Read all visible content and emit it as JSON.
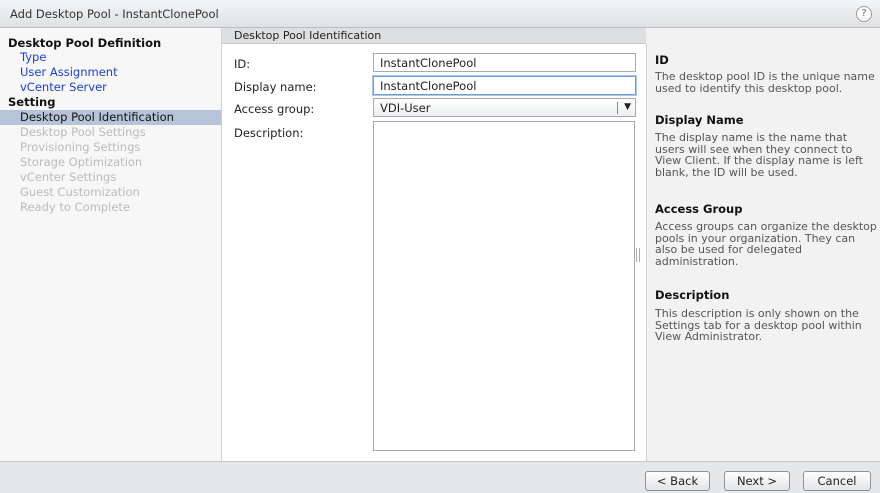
{
  "window": {
    "title": "Add Desktop Pool - InstantClonePool",
    "help_glyph": "?"
  },
  "sidebar": {
    "section1": "Desktop Pool Definition",
    "items1": [
      "Type",
      "User Assignment",
      "vCenter Server"
    ],
    "section2": "Setting",
    "items2": [
      "Desktop Pool Identification",
      "Desktop Pool Settings",
      "Provisioning Settings",
      "Storage Optimization",
      "vCenter Settings",
      "Guest Customization",
      "Ready to Complete"
    ]
  },
  "content": {
    "header": "Desktop Pool Identification",
    "id_label": "ID:",
    "id_value": "InstantClonePool",
    "display_label": "Display name:",
    "display_value": "InstantClonePool",
    "access_label": "Access group:",
    "access_value": "VDI-User",
    "description_label": "Description:",
    "description_value": ""
  },
  "help": {
    "id_title": "ID",
    "id_text": "The desktop pool ID is the unique name used to identify this desktop pool.",
    "display_title": "Display Name",
    "display_text": "The display name is the name that users will see when they connect to View Client. If the display name is left blank, the ID will be used.",
    "access_title": "Access Group",
    "access_text": "Access groups can organize the desktop pools in your organization. They can also be used for delegated administration.",
    "desc_title": "Description",
    "desc_text": "This description is only shown on the Settings tab for a desktop pool within View Administrator."
  },
  "footer": {
    "back": "< Back",
    "next": "Next >",
    "cancel": "Cancel"
  },
  "colors": {
    "link": "#1a3fd4",
    "current_bg": "#b6c3d8",
    "disabled": "#b9bbbe"
  }
}
